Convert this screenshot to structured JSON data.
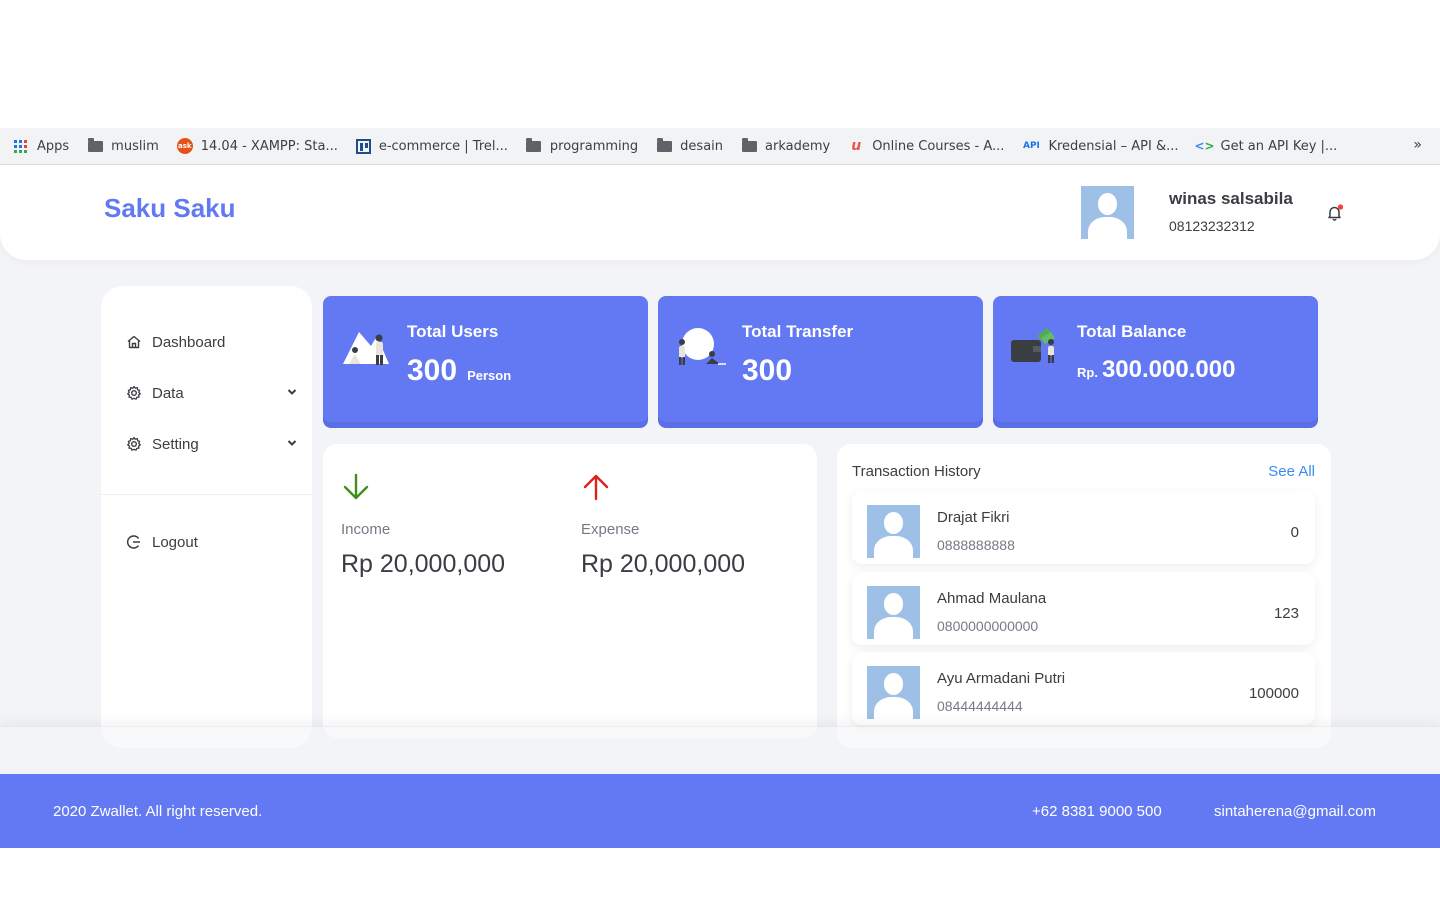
{
  "bookmarks": [
    {
      "label": "Apps",
      "icon": "apps-grid-icon"
    },
    {
      "label": "muslim",
      "icon": "folder-icon"
    },
    {
      "label": "14.04 - XAMPP: Sta...",
      "icon": "ask-icon"
    },
    {
      "label": "e-commerce | Trel...",
      "icon": "trello-icon"
    },
    {
      "label": "programming",
      "icon": "folder-icon"
    },
    {
      "label": "desain",
      "icon": "folder-icon"
    },
    {
      "label": "arkademy",
      "icon": "folder-icon"
    },
    {
      "label": "Online Courses - A...",
      "icon": "udemy-icon"
    },
    {
      "label": "Kredensial – API &...",
      "icon": "api-icon"
    },
    {
      "label": "Get an API Key |...",
      "icon": "code-icon"
    }
  ],
  "bookmarks_more": "»",
  "header": {
    "brand": "Saku Saku",
    "user_name": "winas salsabila",
    "user_phone": "08123232312"
  },
  "sidebar": {
    "dashboard": "Dashboard",
    "data": "Data",
    "setting": "Setting",
    "logout": "Logout"
  },
  "stats": {
    "users_title": "Total Users",
    "users_value": "300",
    "users_unit": "Person",
    "transfer_title": "Total Transfer",
    "transfer_value": "300",
    "balance_title": "Total Balance",
    "balance_prefix": "Rp.",
    "balance_value": "300.000.000"
  },
  "finance": {
    "income_label": "Income",
    "income_amount": "Rp 20,000,000",
    "expense_label": "Expense",
    "expense_amount": "Rp 20,000,000"
  },
  "history": {
    "title": "Transaction History",
    "see_all": "See All",
    "items": [
      {
        "name": "Drajat Fikri",
        "phone": "0888888888",
        "amount": "0"
      },
      {
        "name": "Ahmad Maulana",
        "phone": "0800000000000",
        "amount": "123"
      },
      {
        "name": "Ayu Armadani Putri",
        "phone": "08444444444",
        "amount": "100000"
      }
    ]
  },
  "footer": {
    "copyright": "2020 Zwallet. All right reserved.",
    "phone": "+62 8381 9000 500",
    "email": "sintaherena@gmail.com"
  },
  "colors": {
    "primary": "#6379f4",
    "income_arrow": "#1ec15f",
    "expense_arrow": "#ff5b37"
  }
}
